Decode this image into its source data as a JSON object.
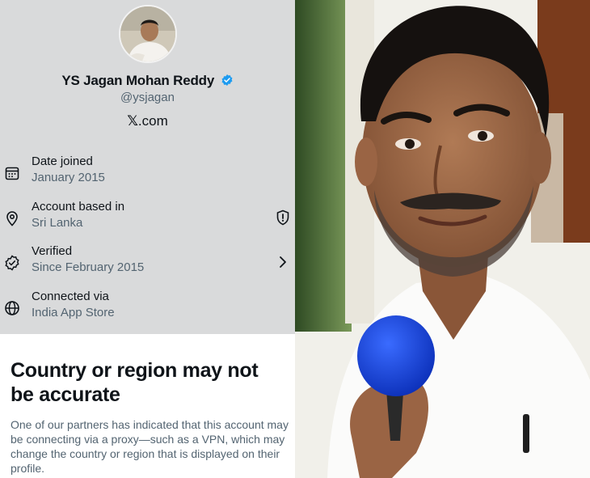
{
  "profile": {
    "name": "YS Jagan Mohan Reddy",
    "handle": "@ysjagan",
    "site": "X.com",
    "site_mark": "𝕏",
    "site_suffix": ".com",
    "verified_icon": "verified-badge-icon",
    "accent_color": "#1d9bf0"
  },
  "details": [
    {
      "icon": "calendar-icon",
      "title": "Date joined",
      "value": "January 2015"
    },
    {
      "icon": "location-pin-icon",
      "title": "Account based in",
      "value": "Sri Lanka",
      "action_icon": "shield-alert-icon"
    },
    {
      "icon": "verified-check-icon",
      "title": "Verified",
      "value": "Since February 2015",
      "action_icon": "chevron-right-icon"
    },
    {
      "icon": "globe-icon",
      "title": "Connected via",
      "value": "India App Store"
    }
  ],
  "notice": {
    "title": "Country or region may not be accurate",
    "body": "One of our partners has indicated that this account may be connecting via a proxy—such as a VPN, which may change the country or region that is displayed on their profile."
  },
  "photo": {
    "subject": "man-speaking-into-blue-microphone"
  }
}
